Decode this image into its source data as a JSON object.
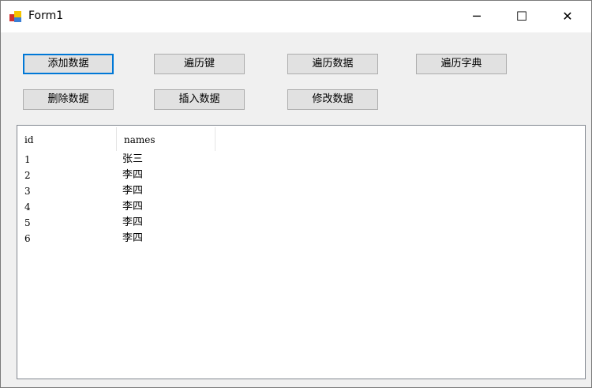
{
  "window": {
    "title": "Form1",
    "minimize": "─",
    "maximize": "☐",
    "close": "✕"
  },
  "buttons": {
    "add": "添加数据",
    "iterate_keys": "遍历键",
    "iterate_data": "遍历数据",
    "iterate_dict": "遍历字典",
    "delete": "删除数据",
    "insert": "插入数据",
    "modify": "修改数据"
  },
  "list": {
    "columns": [
      "id",
      "names"
    ],
    "rows": [
      [
        "1",
        "张三"
      ],
      [
        "2",
        "李四"
      ],
      [
        "3",
        "李四"
      ],
      [
        "4",
        "李四"
      ],
      [
        "5",
        "李四"
      ],
      [
        "6",
        "李四"
      ]
    ]
  }
}
